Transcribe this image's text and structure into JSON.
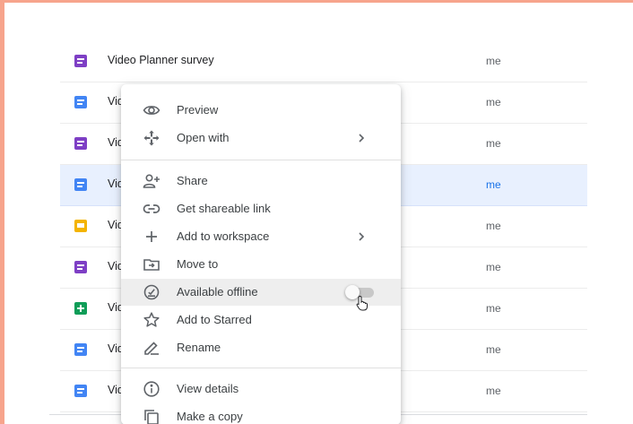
{
  "files": [
    {
      "name": "Video Planner survey",
      "type": "form",
      "owner": "me",
      "selected": false
    },
    {
      "name": "Vid",
      "type": "doc",
      "owner": "me",
      "selected": false
    },
    {
      "name": "Vid",
      "type": "form",
      "owner": "me",
      "selected": false
    },
    {
      "name": "Vid",
      "type": "doc",
      "owner": "me",
      "selected": true
    },
    {
      "name": "Vid",
      "type": "slides",
      "owner": "me",
      "selected": false
    },
    {
      "name": "Vid",
      "type": "form",
      "owner": "me",
      "selected": false
    },
    {
      "name": "Vid",
      "type": "sheet",
      "owner": "me",
      "selected": false
    },
    {
      "name": "Vid",
      "type": "doc",
      "owner": "me",
      "selected": false
    },
    {
      "name": "Vid",
      "type": "doc",
      "owner": "me",
      "selected": false
    }
  ],
  "context_menu": {
    "items": [
      {
        "label": "Preview",
        "icon": "eye-icon"
      },
      {
        "label": "Open with",
        "icon": "move-arrows-icon",
        "submenu": true
      },
      {
        "label": "Share",
        "icon": "add-person-icon"
      },
      {
        "label": "Get shareable link",
        "icon": "link-icon"
      },
      {
        "label": "Add to workspace",
        "icon": "plus-icon",
        "submenu": true
      },
      {
        "label": "Move to",
        "icon": "folder-move-icon"
      },
      {
        "label": "Available offline",
        "icon": "offline-check-icon",
        "toggle": false,
        "hovered": true
      },
      {
        "label": "Add to Starred",
        "icon": "star-icon"
      },
      {
        "label": "Rename",
        "icon": "pencil-icon"
      },
      {
        "label": "View details",
        "icon": "info-icon"
      },
      {
        "label": "Make a copy",
        "icon": "copy-icon"
      }
    ]
  },
  "colors": {
    "frame_border": "#f7a48c",
    "doc": "#4285f4",
    "form": "#7e3fc5",
    "slides": "#f4b400",
    "sheet": "#0f9d58",
    "selection": "#e8f0fe"
  }
}
